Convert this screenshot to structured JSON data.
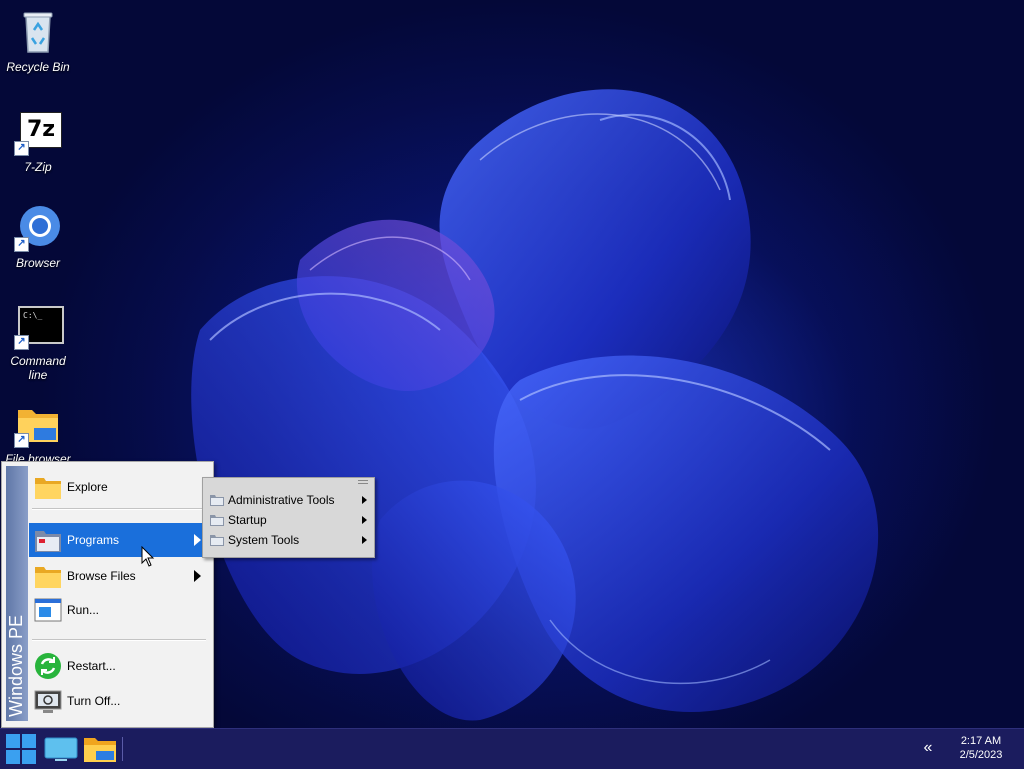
{
  "desktop": {
    "icons": [
      {
        "label": "Recycle Bin",
        "icon": "recycle-bin-icon"
      },
      {
        "label": "7-Zip",
        "icon": "7zip-icon",
        "glyph": "7z"
      },
      {
        "label": "Browser",
        "icon": "chromium-icon"
      },
      {
        "label": "Command line",
        "icon": "command-prompt-icon",
        "glyph": "C:\\_"
      },
      {
        "label": "File browser",
        "icon": "folder-icon"
      }
    ]
  },
  "start_menu": {
    "banner": "Windows PE",
    "items": [
      {
        "label": "Explore",
        "icon": "folder-icon",
        "has_submenu": false
      },
      {
        "label": "Programs",
        "icon": "programs-icon",
        "has_submenu": true,
        "active": true
      },
      {
        "label": "Browse Files",
        "icon": "folder-icon",
        "has_submenu": true
      },
      {
        "label": "Run...",
        "icon": "run-icon",
        "has_submenu": false
      },
      {
        "label": "Restart...",
        "icon": "restart-icon",
        "has_submenu": false
      },
      {
        "label": "Turn Off...",
        "icon": "turn-off-icon",
        "has_submenu": false
      }
    ]
  },
  "programs_submenu": {
    "items": [
      {
        "label": "Administrative Tools",
        "icon": "program-folder-icon"
      },
      {
        "label": "Startup",
        "icon": "program-folder-icon"
      },
      {
        "label": "System Tools",
        "icon": "program-folder-icon"
      }
    ]
  },
  "taskbar": {
    "start_icon": "windows-logo-icon",
    "pinned": [
      {
        "icon": "desktop-icon"
      },
      {
        "icon": "file-explorer-icon"
      }
    ],
    "tray_chevron": "«",
    "clock": {
      "time": "2:17 AM",
      "date": "2/5/2023"
    }
  },
  "colors": {
    "accent": "#1a6fdb",
    "taskbar": "#1b1c5e",
    "banner": "#6d84b4"
  }
}
